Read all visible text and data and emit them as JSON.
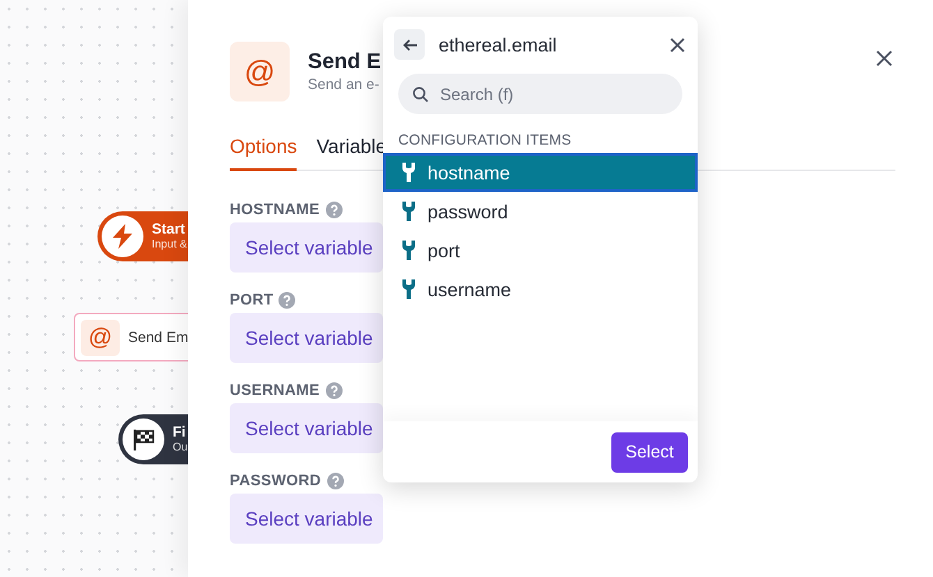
{
  "canvas": {
    "nodes": [
      {
        "kind": "start",
        "title": "Start",
        "subtitle": "Input &"
      },
      {
        "kind": "action",
        "icon": "@",
        "title": "Send Em"
      },
      {
        "kind": "finish",
        "title": "Fi",
        "subtitle": "Ou"
      }
    ]
  },
  "panel": {
    "icon": "@",
    "title": "Send E",
    "subtitle": "Send an e-",
    "tabs": [
      {
        "label": "Options",
        "selected": true
      },
      {
        "label": "Variable",
        "selected": false
      }
    ],
    "fields": [
      {
        "label": "HOSTNAME",
        "placeholder": "Select variable"
      },
      {
        "label": "PORT",
        "placeholder": "Select variable"
      },
      {
        "label": "USERNAME",
        "placeholder": "Select variable"
      },
      {
        "label": "PASSWORD",
        "placeholder": "Select variable"
      }
    ]
  },
  "popup": {
    "title": "ethereal.email",
    "search": {
      "placeholder": "Search (f)"
    },
    "section": "CONFIGURATION ITEMS",
    "items": [
      {
        "label": "hostname",
        "selected": true
      },
      {
        "label": "password",
        "selected": false
      },
      {
        "label": "port",
        "selected": false
      },
      {
        "label": "username",
        "selected": false
      }
    ],
    "button": "Select"
  }
}
